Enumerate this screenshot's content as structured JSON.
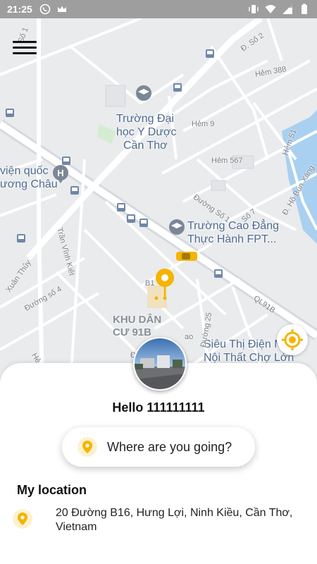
{
  "status_bar": {
    "time": "21:25",
    "icons_left": [
      "viber-icon",
      "crown-icon"
    ],
    "icons_right": [
      "vibrate-icon",
      "wifi-icon",
      "signal-icon",
      "battery-icon"
    ]
  },
  "map": {
    "pois": [
      {
        "name": "Trường Đại học Y Dược Cần Thơ",
        "lines": [
          "Trường Đại",
          "học Y Dược",
          "Cần Thơ"
        ]
      },
      {
        "name": "viện quốc ương Châu",
        "lines": [
          "viện quốc",
          "ương Châu"
        ]
      },
      {
        "name": "Trường Cao Đẳng Thực Hành FPT",
        "lines": [
          "Trường Cao Đẳng",
          "Thực Hành FPT..."
        ]
      },
      {
        "name": "Siêu Thị Điện Máy Nội Thất Chợ Lớn",
        "lines": [
          "Siêu Thị Điện M",
          "Nội Thất Chợ Lớn"
        ]
      }
    ],
    "area_label": [
      "KHU DÂN",
      "CƯ 91B"
    ],
    "streets": [
      "Số 1",
      "Đ. Số 2",
      "Hẻm 388",
      "Hẻm 9",
      "Hẻm 51",
      "Hẻm 567",
      "Đ. Hồ Bún Xáng",
      "Đường Số 1",
      "Số 7",
      "Trần Vĩnh Kiết",
      "Xuân Thủy",
      "Đường số 4",
      "B1",
      "QL91B",
      "Đường 25",
      "ao",
      "Hẻ",
      "Đ"
    ]
  },
  "user": {
    "greeting": "Hello 111111111"
  },
  "search": {
    "placeholder": "Where are you going?"
  },
  "my_location": {
    "title": "My location",
    "address": "20 Đường B16, Hưng Lợi, Ninh Kiều, Cần Thơ, Vietnam"
  },
  "colors": {
    "accent": "#f5b400",
    "status_bar": "#9e9e9e",
    "map_bg": "#e9ebed",
    "poi_text": "#4f6b8f"
  }
}
